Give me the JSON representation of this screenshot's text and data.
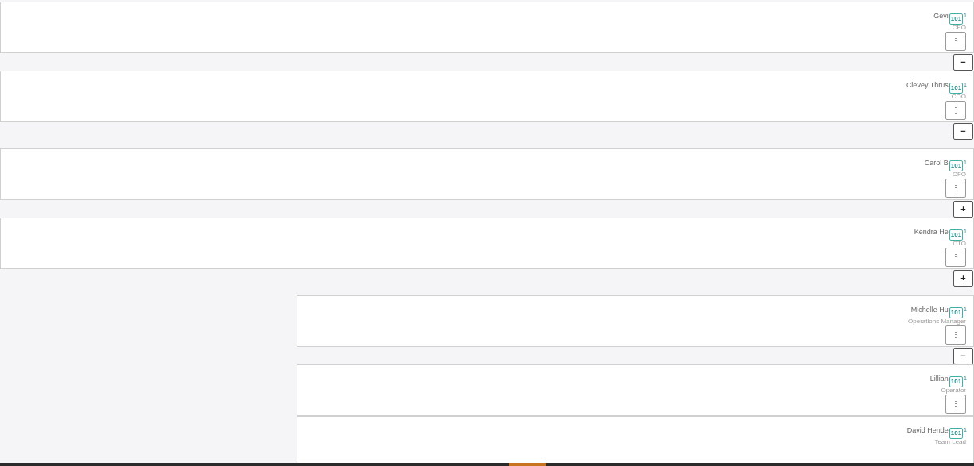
{
  "nodes": [
    {
      "name": "Gevi",
      "badge": "101",
      "badge_count": "1",
      "title": "CEO",
      "menu": "⋮",
      "expanded": true
    },
    {
      "name": "Clevey Thrus",
      "badge": "101",
      "badge_count": "1",
      "title": "COO",
      "menu": "⋮",
      "expanded": true
    },
    {
      "name": "Carol B",
      "badge": "101",
      "badge_count": "1",
      "title": "CFO",
      "menu": "⋮",
      "expanded": false
    },
    {
      "name": "Kendra He",
      "badge": "101",
      "badge_count": "1",
      "title": "CTO",
      "menu": "⋮",
      "expanded": false,
      "children": [
        {
          "name": "Michelle Hu",
          "badge": "101",
          "badge_count": "1",
          "title": "Operations Manager",
          "menu": "⋮",
          "expanded": true
        },
        {
          "name": "Lillian",
          "badge": "101",
          "badge_count": "1",
          "title": "Operator",
          "menu": "⋮"
        },
        {
          "name": "David Hende",
          "badge": "101",
          "badge_count": "1",
          "title": "Team Lead"
        }
      ]
    }
  ],
  "toggle_symbols": {
    "expanded": "−",
    "collapsed": "+"
  }
}
